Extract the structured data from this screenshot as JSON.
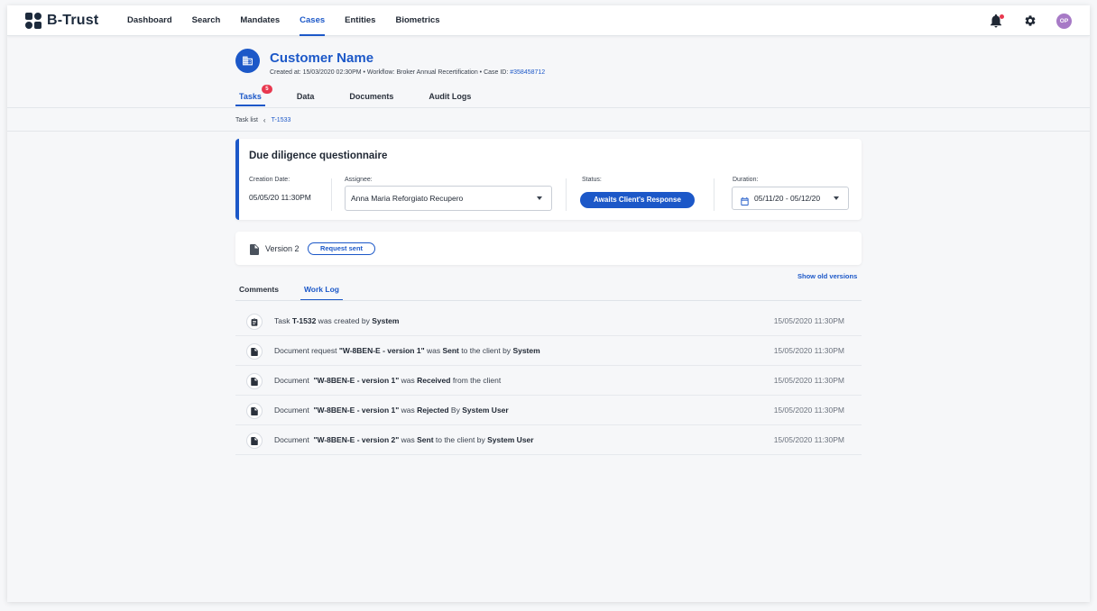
{
  "app": {
    "name": "B-Trust"
  },
  "nav": {
    "items": [
      {
        "label": "Dashboard",
        "active": false
      },
      {
        "label": "Search",
        "active": false
      },
      {
        "label": "Mandates",
        "active": false
      },
      {
        "label": "Cases",
        "active": true
      },
      {
        "label": "Entities",
        "active": false
      },
      {
        "label": "Biometrics",
        "active": false
      }
    ],
    "avatar_initials": "OP"
  },
  "case": {
    "title": "Customer Name",
    "meta_prefix": "Created at: 15/03/2020 02:30PM • Workflow: Broker Annual Recertification • Case ID: ",
    "case_id": "#358458712"
  },
  "tabs": [
    {
      "label": "Tasks",
      "badge": "5",
      "active": true
    },
    {
      "label": "Data",
      "active": false
    },
    {
      "label": "Documents",
      "active": false
    },
    {
      "label": "Audit Logs",
      "active": false
    }
  ],
  "breadcrumb": {
    "parent": "Task list",
    "current": "T-1533"
  },
  "task": {
    "title": "Due diligence questionnaire",
    "creation_date_label": "Creation Date:",
    "creation_date": "05/05/20 11:30PM",
    "assignee_label": "Assignee:",
    "assignee": "Anna Maria Reforgiato Recupero",
    "status_label": "Status:",
    "status": "Awaits Client's Response",
    "duration_label": "Duration:",
    "duration": "05/11/20 - 05/12/20"
  },
  "version": {
    "label": "Version 2",
    "status": "Request sent",
    "show_old": "Show old versions"
  },
  "sub_tabs": [
    {
      "label": "Comments",
      "active": false
    },
    {
      "label": "Work Log",
      "active": true
    }
  ],
  "work_log": [
    {
      "parts": [
        {
          "t": "Task "
        },
        {
          "t": "T-1532",
          "b": true
        },
        {
          "t": " was created by "
        },
        {
          "t": "System",
          "b": true
        }
      ],
      "time": "15/05/2020 11:30PM",
      "icon": "task-icon"
    },
    {
      "parts": [
        {
          "t": "Document request "
        },
        {
          "t": "\"W-8BEN-E - version 1\"",
          "b": true
        },
        {
          "t": " was "
        },
        {
          "t": "Sent",
          "b": true
        },
        {
          "t": " to the client by "
        },
        {
          "t": "System",
          "b": true
        }
      ],
      "time": "15/05/2020 11:30PM",
      "icon": "document-icon"
    },
    {
      "parts": [
        {
          "t": "Document  "
        },
        {
          "t": "\"W-8BEN-E - version 1\"",
          "b": true
        },
        {
          "t": " was "
        },
        {
          "t": "Received",
          "b": true
        },
        {
          "t": " from the client"
        }
      ],
      "time": "15/05/2020 11:30PM",
      "icon": "document-icon"
    },
    {
      "parts": [
        {
          "t": "Document  "
        },
        {
          "t": "\"W-8BEN-E - version 1\"",
          "b": true
        },
        {
          "t": " was "
        },
        {
          "t": "Rejected",
          "b": true
        },
        {
          "t": " By "
        },
        {
          "t": "System User",
          "b": true
        }
      ],
      "time": "15/05/2020 11:30PM",
      "icon": "document-icon"
    },
    {
      "parts": [
        {
          "t": "Document  "
        },
        {
          "t": "\"W-8BEN-E - version 2\"",
          "b": true
        },
        {
          "t": " was "
        },
        {
          "t": "Sent",
          "b": true
        },
        {
          "t": " to the client by "
        },
        {
          "t": "System User",
          "b": true
        }
      ],
      "time": "15/05/2020 11:30PM",
      "icon": "document-icon"
    }
  ],
  "colors": {
    "accent": "#1c58c8",
    "badge": "#e8384f",
    "avatar": "#a77ac6"
  }
}
